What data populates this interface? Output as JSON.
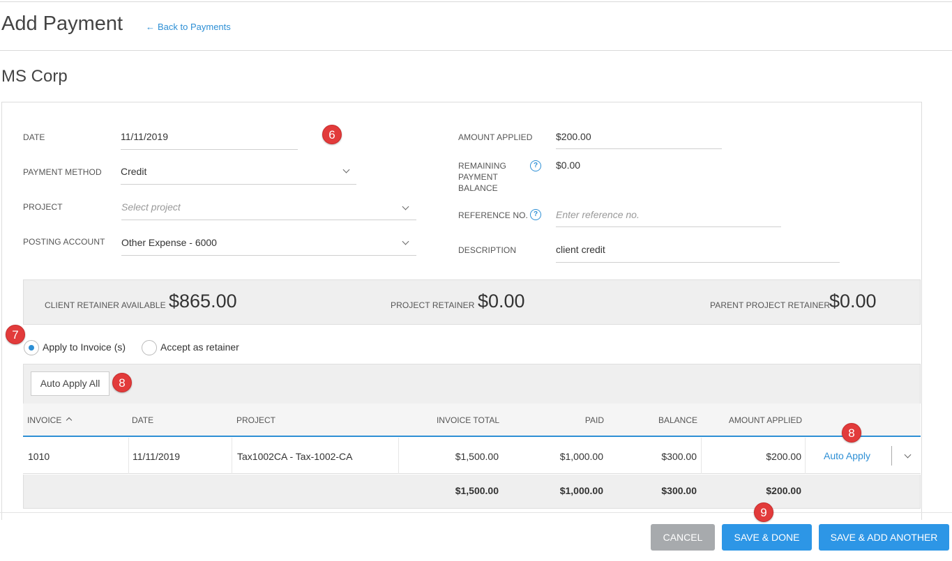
{
  "header": {
    "title": "Add Payment",
    "back_link": "Back to Payments",
    "back_arrow": "←"
  },
  "client": {
    "name": "MS Corp"
  },
  "form": {
    "date": {
      "label": "DATE",
      "value": "11/11/2019"
    },
    "payment_method": {
      "label": "PAYMENT METHOD",
      "value": "Credit"
    },
    "project": {
      "label": "PROJECT",
      "placeholder": "Select project"
    },
    "posting_account": {
      "label": "POSTING ACCOUNT",
      "value": "Other Expense - 6000"
    },
    "amount_applied": {
      "label": "AMOUNT APPLIED",
      "value": "$200.00"
    },
    "remaining_balance": {
      "label_1": "REMAINING",
      "label_2": "PAYMENT",
      "label_3": "BALANCE",
      "value": "$0.00"
    },
    "reference_no": {
      "label": "REFERENCE NO.",
      "placeholder": "Enter reference no."
    },
    "description": {
      "label": "DESCRIPTION",
      "value": "client credit"
    }
  },
  "retainers": {
    "client": {
      "label": "CLIENT RETAINER AVAILABLE",
      "value": "$865.00"
    },
    "project": {
      "label": "PROJECT RETAINER",
      "value": "$0.00"
    },
    "parent_project": {
      "label": "PARENT PROJECT RETAINER",
      "value": "$0.00"
    }
  },
  "apply_options": {
    "apply_invoice": "Apply to Invoice (s)",
    "accept_retainer": "Accept as retainer",
    "selected": "apply_invoice"
  },
  "table": {
    "auto_apply_all": "Auto Apply All",
    "columns": [
      "INVOICE",
      "DATE",
      "PROJECT",
      "INVOICE TOTAL",
      "PAID",
      "BALANCE",
      "AMOUNT APPLIED"
    ],
    "rows": [
      {
        "invoice": "1010",
        "date": "11/11/2019",
        "project": "Tax1002CA - Tax-1002-CA",
        "invoice_total": "$1,500.00",
        "paid": "$1,000.00",
        "balance": "$300.00",
        "amount_applied": "$200.00",
        "action": "Auto Apply"
      }
    ],
    "totals": {
      "invoice_total": "$1,500.00",
      "paid": "$1,000.00",
      "balance": "$300.00",
      "amount_applied": "$200.00"
    }
  },
  "annotations": {
    "b6": "6",
    "b7": "7",
    "b8a": "8",
    "b8b": "8",
    "b9": "9"
  },
  "help_glyph": "?",
  "footer": {
    "cancel": "CANCEL",
    "save_done": "SAVE & DONE",
    "save_add": "SAVE & ADD ANOTHER"
  },
  "colors": {
    "accent": "#2d96e6",
    "badge": "#e23b3b",
    "cancel": "#a7aaad"
  }
}
